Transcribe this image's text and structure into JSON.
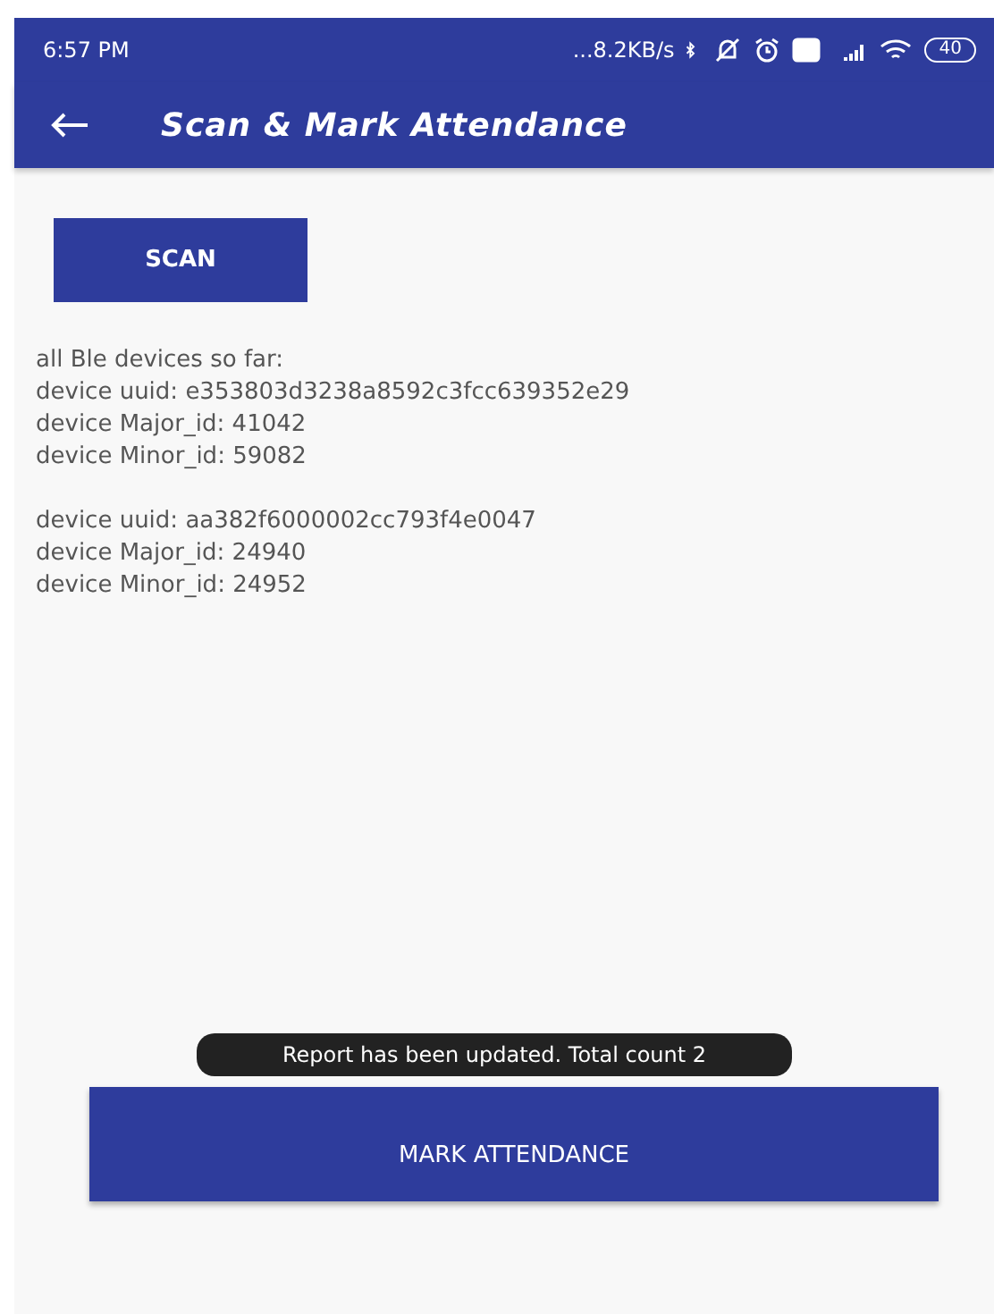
{
  "status_bar": {
    "time": "6:57 PM",
    "net_speed": "...8.2KB/s",
    "battery": "40"
  },
  "app_bar": {
    "title": "Scan & Mark Attendance"
  },
  "scan_button": {
    "label": "SCAN"
  },
  "device_list": {
    "heading": "all Ble devices so far:",
    "devices": [
      {
        "uuid": "device uuid: e353803d3238a8592c3fcc639352e29",
        "major": "device Major_id: 41042",
        "minor": "device Minor_id: 59082"
      },
      {
        "uuid": "device uuid: aa382f6000002cc793f4e0047",
        "major": "device Major_id: 24940",
        "minor": "device Minor_id: 24952"
      }
    ]
  },
  "mark_button": {
    "label": "MARK ATTENDANCE"
  },
  "toast": {
    "message": "Report has been updated. Total count 2"
  }
}
